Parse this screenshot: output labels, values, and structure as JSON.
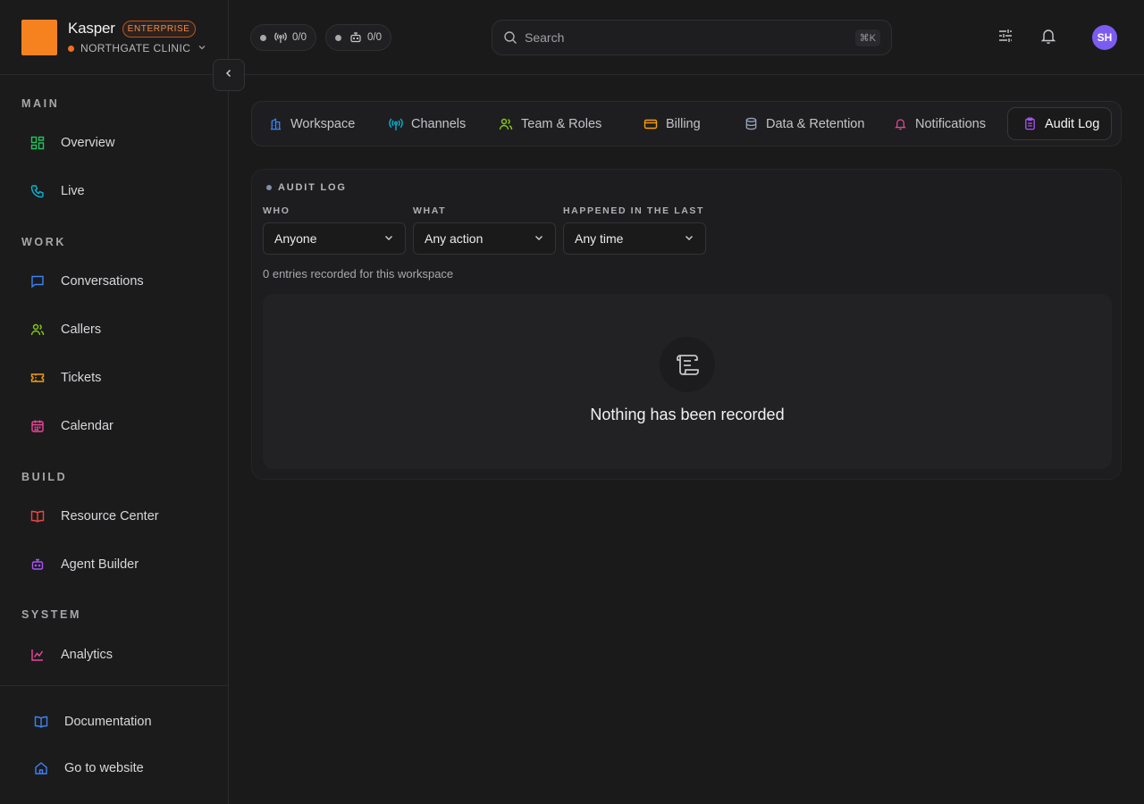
{
  "brand": {
    "name": "Kasper",
    "badge": "ENTERPRISE",
    "org": "NORTHGATE CLINIC"
  },
  "status_pills": [
    {
      "value": "0/0",
      "icon": "antenna-icon"
    },
    {
      "value": "0/0",
      "icon": "bot-icon"
    }
  ],
  "search": {
    "placeholder": "Search",
    "shortcut": "⌘K"
  },
  "user": {
    "initials": "SH"
  },
  "sidebar": {
    "sections": [
      "MAIN",
      "WORK",
      "BUILD",
      "SYSTEM"
    ],
    "items": [
      {
        "label": "Overview",
        "icon": "grid-icon",
        "color": "#22c55e"
      },
      {
        "label": "Live",
        "icon": "phone-icon",
        "color": "#06b6d4"
      },
      {
        "label": "Conversations",
        "icon": "chat-icon",
        "color": "#3b82f6"
      },
      {
        "label": "Callers",
        "icon": "users-icon",
        "color": "#84cc16"
      },
      {
        "label": "Tickets",
        "icon": "ticket-icon",
        "color": "#f59e0b"
      },
      {
        "label": "Calendar",
        "icon": "calendar-icon",
        "color": "#ec4899"
      },
      {
        "label": "Resource Center",
        "icon": "book-icon",
        "color": "#ef4444"
      },
      {
        "label": "Agent Builder",
        "icon": "bot-icon",
        "color": "#a855f7"
      },
      {
        "label": "Analytics",
        "icon": "chart-icon",
        "color": "#ec4899"
      }
    ],
    "bottom": [
      {
        "label": "Documentation",
        "icon": "book-icon",
        "color": "#3b82f6"
      },
      {
        "label": "Go to website",
        "icon": "home-icon",
        "color": "#3b82f6"
      }
    ]
  },
  "tabs": [
    {
      "label": "Workspace",
      "icon": "building-icon",
      "color": "#3b82f6"
    },
    {
      "label": "Channels",
      "icon": "antenna-icon",
      "color": "#06b6d4"
    },
    {
      "label": "Team & Roles",
      "icon": "users-icon",
      "color": "#84cc16"
    },
    {
      "label": "Billing",
      "icon": "card-icon",
      "color": "#f59e0b"
    },
    {
      "label": "Data & Retention",
      "icon": "database-icon",
      "color": "#94a3b8"
    },
    {
      "label": "Notifications",
      "icon": "bell-icon",
      "color": "#ec4899"
    },
    {
      "label": "Audit Log",
      "icon": "clipboard-icon",
      "color": "#a855f7",
      "active": true
    }
  ],
  "audit": {
    "title": "AUDIT LOG",
    "filters": [
      {
        "label": "WHO",
        "value": "Anyone"
      },
      {
        "label": "WHAT",
        "value": "Any action"
      },
      {
        "label": "HAPPENED IN THE LAST",
        "value": "Any time"
      }
    ],
    "entries_text": "0 entries recorded for this workspace",
    "empty_text": "Nothing has been recorded"
  }
}
